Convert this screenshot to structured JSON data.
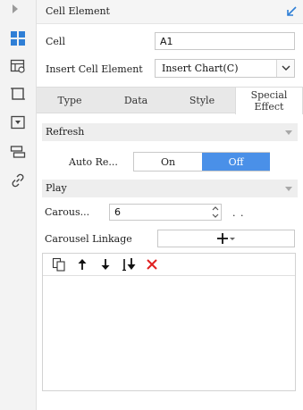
{
  "header": {
    "title": "Cell Element"
  },
  "sidebar": {
    "items": [
      {
        "icon": "expand-arrow-icon"
      },
      {
        "icon": "cell-element-icon",
        "active": true
      },
      {
        "icon": "data-grid-icon"
      },
      {
        "icon": "frame-icon"
      },
      {
        "icon": "dropdown-widget-icon"
      },
      {
        "icon": "layers-icon"
      },
      {
        "icon": "link-icon"
      }
    ]
  },
  "form": {
    "cell_label": "Cell",
    "cell_value": "A1",
    "insert_label": "Insert Cell Element",
    "insert_value": "Insert Chart(C)"
  },
  "tabs": [
    {
      "label": "Type"
    },
    {
      "label": "Data"
    },
    {
      "label": "Style"
    },
    {
      "label": "Special Effect",
      "active": true
    }
  ],
  "refresh": {
    "title": "Refresh",
    "auto_label": "Auto Re...",
    "on_label": "On",
    "off_label": "Off",
    "selected": "Off"
  },
  "play": {
    "title": "Play",
    "carousel_label": "Carous...",
    "carousel_value": "6",
    "unit": ". .",
    "linkage_label": "Carousel Linkage"
  },
  "colors": {
    "accent": "#4a90e8",
    "delete": "#e02020"
  }
}
